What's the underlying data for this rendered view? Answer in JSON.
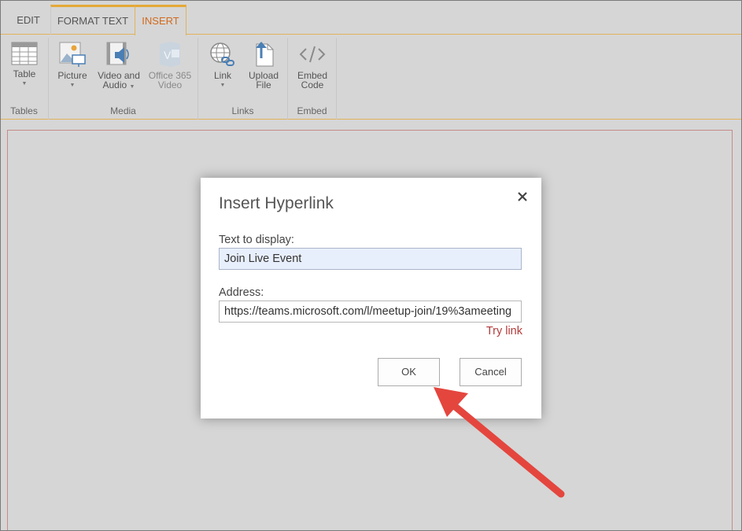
{
  "tabs": [
    {
      "label": "EDIT"
    },
    {
      "label": "FORMAT TEXT"
    },
    {
      "label": "INSERT",
      "active": true
    }
  ],
  "ribbon": {
    "tables": {
      "label": "Tables",
      "table": {
        "label": "Table",
        "icon": "table-icon"
      }
    },
    "media": {
      "label": "Media",
      "picture": {
        "label": "Picture",
        "icon": "picture-icon"
      },
      "video_audio": {
        "label1": "Video and",
        "label2": "Audio",
        "icon": "video-audio-icon"
      },
      "office365": {
        "label1": "Office 365",
        "label2": "Video",
        "icon": "office365-video-icon"
      }
    },
    "links": {
      "label": "Links",
      "link": {
        "label": "Link",
        "icon": "globe-link-icon"
      },
      "upload": {
        "label1": "Upload",
        "label2": "File",
        "icon": "upload-file-icon"
      }
    },
    "embed": {
      "label": "Embed",
      "embed_code": {
        "label1": "Embed",
        "label2": "Code",
        "icon": "code-icon"
      }
    }
  },
  "dialog": {
    "title": "Insert Hyperlink",
    "text_label": "Text to display:",
    "text_value": "Join Live Event",
    "address_label": "Address:",
    "address_value": "https://teams.microsoft.com/l/meetup-join/19%3ameeting",
    "try_link": "Try link",
    "ok": "OK",
    "cancel": "Cancel"
  },
  "colors": {
    "accent_tab": "#d26a1c",
    "tab_border": "#e5a936",
    "arrow": "#e4463e",
    "try_link": "#b33a3a"
  }
}
